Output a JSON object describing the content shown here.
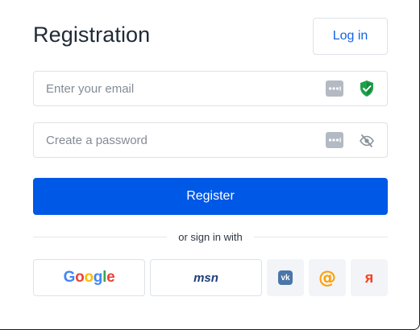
{
  "header": {
    "title": "Registration",
    "login_label": "Log in"
  },
  "form": {
    "email": {
      "value": "",
      "placeholder": "Enter your email",
      "icons": [
        "password-manager-icon",
        "shield-check-icon"
      ]
    },
    "password": {
      "value": "",
      "placeholder": "Create a password",
      "icons": [
        "password-manager-icon",
        "eye-slash-icon"
      ]
    },
    "register_label": "Register"
  },
  "divider": {
    "label": "or sign in with"
  },
  "social": {
    "google": {
      "logo_text": [
        "G",
        "o",
        "o",
        "g",
        "l",
        "e"
      ]
    },
    "msn": {
      "logo_text": "msn"
    },
    "vk": {
      "logo_text": "vk"
    },
    "mail": {
      "logo_text": "@"
    },
    "yandex": {
      "logo_text": "я"
    }
  },
  "colors": {
    "accent": "#0058e6",
    "link": "#1463e6",
    "border": "#dde2e7",
    "shield": "#1fa14a"
  }
}
